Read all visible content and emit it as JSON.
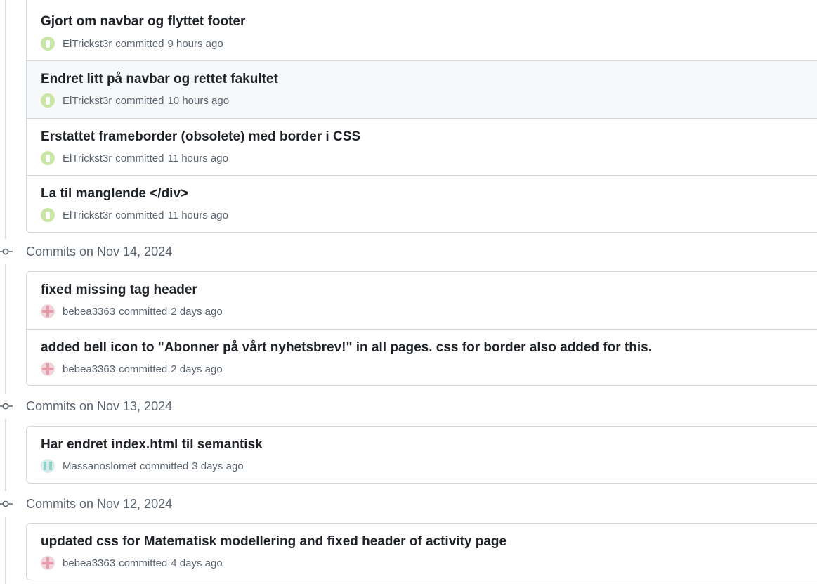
{
  "groups": [
    {
      "label": "",
      "commits": [
        {
          "title": "Gjort om navbar og flyttet footer",
          "author": "ElTrickst3r",
          "action": "committed",
          "time": "9 hours ago",
          "avatar": "green-avatar-icon",
          "hover": false
        },
        {
          "title": "Endret litt på navbar og rettet fakultet",
          "author": "ElTrickst3r",
          "action": "committed",
          "time": "10 hours ago",
          "avatar": "green-avatar-icon",
          "hover": true
        },
        {
          "title": "Erstattet frameborder (obsolete) med border i CSS",
          "author": "ElTrickst3r",
          "action": "committed",
          "time": "11 hours ago",
          "avatar": "green-avatar-icon",
          "hover": false
        },
        {
          "title": "La til manglende </div>",
          "author": "ElTrickst3r",
          "action": "committed",
          "time": "11 hours ago",
          "avatar": "green-avatar-icon",
          "hover": false
        }
      ]
    },
    {
      "label": "Commits on Nov 14, 2024",
      "commits": [
        {
          "title": "fixed missing tag header",
          "author": "bebea3363",
          "action": "committed",
          "time": "2 days ago",
          "avatar": "pink-avatar-icon",
          "hover": false
        },
        {
          "title": "added bell icon to \"Abonner på vårt nyhetsbrev!\" in all pages. css for border also added for this.",
          "author": "bebea3363",
          "action": "committed",
          "time": "2 days ago",
          "avatar": "pink-avatar-icon",
          "hover": false
        }
      ]
    },
    {
      "label": "Commits on Nov 13, 2024",
      "commits": [
        {
          "title": "Har endret index.html til semantisk",
          "author": "Massanoslomet",
          "action": "committed",
          "time": "3 days ago",
          "avatar": "teal-avatar-icon",
          "hover": false
        }
      ]
    },
    {
      "label": "Commits on Nov 12, 2024",
      "commits": [
        {
          "title": "updated css for Matematisk modellering and fixed header of activity page",
          "author": "bebea3363",
          "action": "committed",
          "time": "4 days ago",
          "avatar": "pink-avatar-icon",
          "hover": false
        }
      ]
    }
  ],
  "colors": {
    "text": "#1f2328",
    "muted": "#59636e",
    "border": "#d1d9e0",
    "hover_bg": "#f6f8fa",
    "timeline": "#d8dee4"
  }
}
